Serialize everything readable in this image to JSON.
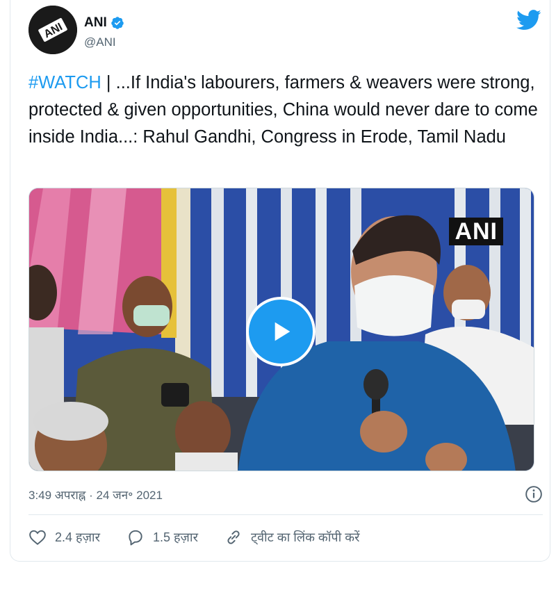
{
  "tweet": {
    "author_name": "ANI",
    "author_handle": "@ANI",
    "avatar_text": "ANI",
    "text_hashtag": "#WATCH",
    "text_body": " | ...If India's labourers, farmers & weavers were strong, protected & given opportunities, China would never dare to come inside India...: Rahul Gandhi, Congress in Erode, Tamil Nadu",
    "video_watermark": "ANI",
    "timestamp": "3:49 अपराह्न · 24 जन॰ 2021"
  },
  "actions": {
    "likes": "2.4 हज़ार",
    "replies": "1.5 हज़ार",
    "copy_link": "ट्वीट का लिंक कॉपी करें"
  },
  "colors": {
    "accent": "#1d9bf0",
    "secondary_text": "#536471",
    "border": "#e1e8ed"
  },
  "icons": [
    "verified-badge-icon",
    "twitter-bird-icon",
    "play-icon",
    "info-icon",
    "heart-icon",
    "reply-icon",
    "link-icon"
  ]
}
